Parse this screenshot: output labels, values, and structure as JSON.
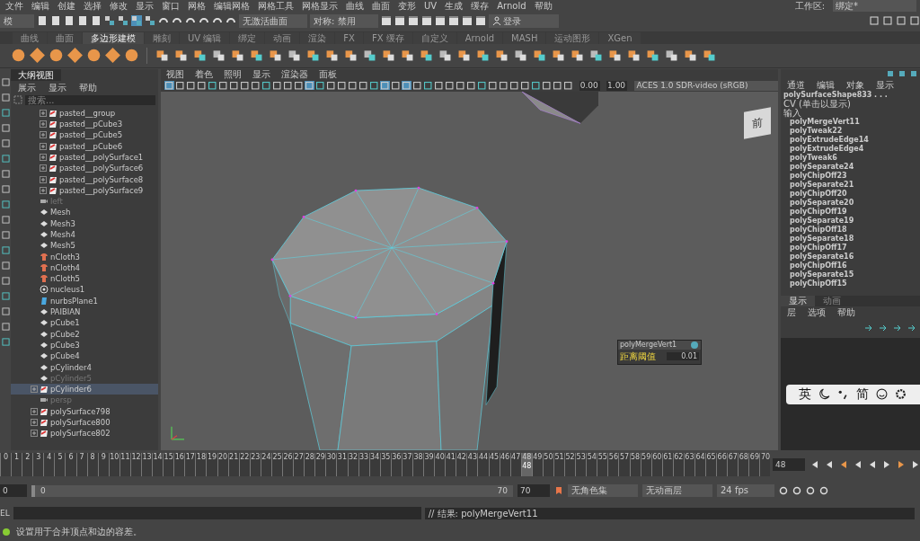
{
  "menu_bar": {
    "items": [
      "文件",
      "编辑",
      "创建",
      "选择",
      "修改",
      "显示",
      "窗口",
      "网格",
      "编辑网格",
      "网格工具",
      "网格显示",
      "曲线",
      "曲面",
      "变形",
      "UV",
      "生成",
      "缓存",
      "Arnold",
      "帮助"
    ],
    "workspace_label": "工作区:",
    "workspace": "绑定*"
  },
  "status_line": {
    "mode": "模",
    "surface": "无激活曲面",
    "symmetry": "对称: 禁用",
    "login": "登录"
  },
  "shelf_tabs": [
    {
      "label": "曲线",
      "selected": false
    },
    {
      "label": "曲面",
      "selected": false
    },
    {
      "label": "多边形建模",
      "selected": true
    },
    {
      "label": "雕刻",
      "selected": false
    },
    {
      "label": "UV 编辑",
      "selected": false
    },
    {
      "label": "绑定",
      "selected": false
    },
    {
      "label": "动画",
      "selected": false
    },
    {
      "label": "渲染",
      "selected": false
    },
    {
      "label": "FX",
      "selected": false
    },
    {
      "label": "FX 缓存",
      "selected": false
    },
    {
      "label": "自定义",
      "selected": false
    },
    {
      "label": "Arnold",
      "selected": false
    },
    {
      "label": "MASH",
      "selected": false
    },
    {
      "label": "运动图形",
      "selected": false
    },
    {
      "label": "XGen",
      "selected": false
    }
  ],
  "outliner": {
    "title": "大纲视图",
    "menu": [
      "展示",
      "显示",
      "帮助"
    ],
    "search": {
      "placeholder": "搜索..."
    },
    "nested_items": [
      {
        "name": "pasted__group",
        "kind": "group",
        "expandable": true,
        "dimmed": false,
        "selected": false
      },
      {
        "name": "pasted__pCube3",
        "kind": "group",
        "expandable": true,
        "dimmed": false,
        "selected": false
      },
      {
        "name": "pasted__pCube5",
        "kind": "group",
        "expandable": true,
        "dimmed": false,
        "selected": false
      },
      {
        "name": "pasted__pCube6",
        "kind": "group",
        "expandable": true,
        "dimmed": false,
        "selected": false
      },
      {
        "name": "pasted__polySurface1",
        "kind": "group",
        "expandable": true,
        "dimmed": false,
        "selected": false
      },
      {
        "name": "pasted__polySurface6",
        "kind": "group",
        "expandable": true,
        "dimmed": false,
        "selected": false
      },
      {
        "name": "pasted__polySurface8",
        "kind": "group",
        "expandable": true,
        "dimmed": false,
        "selected": false
      },
      {
        "name": "pasted__polySurface9",
        "kind": "group",
        "expandable": true,
        "dimmed": false,
        "selected": false
      }
    ],
    "items": [
      {
        "name": "left",
        "kind": "camera",
        "expandable": false,
        "dimmed": true,
        "selected": false
      },
      {
        "name": "Mesh",
        "kind": "mesh",
        "expandable": false,
        "dimmed": false,
        "selected": false
      },
      {
        "name": "Mesh3",
        "kind": "mesh",
        "expandable": false,
        "dimmed": false,
        "selected": false
      },
      {
        "name": "Mesh4",
        "kind": "mesh",
        "expandable": false,
        "dimmed": false,
        "selected": false
      },
      {
        "name": "Mesh5",
        "kind": "mesh",
        "expandable": false,
        "dimmed": false,
        "selected": false
      },
      {
        "name": "nCloth3",
        "kind": "cloth",
        "expandable": false,
        "dimmed": false,
        "selected": false
      },
      {
        "name": "nCloth4",
        "kind": "cloth",
        "expandable": false,
        "dimmed": false,
        "selected": false
      },
      {
        "name": "nCloth5",
        "kind": "cloth",
        "expandable": false,
        "dimmed": false,
        "selected": false
      },
      {
        "name": "nucleus1",
        "kind": "nucleus",
        "expandable": false,
        "dimmed": false,
        "selected": false
      },
      {
        "name": "nurbsPlane1",
        "kind": "nurbs",
        "expandable": false,
        "dimmed": false,
        "selected": false
      },
      {
        "name": "PAIBIAN",
        "kind": "mesh",
        "expandable": false,
        "dimmed": false,
        "selected": false
      },
      {
        "name": "pCube1",
        "kind": "mesh",
        "expandable": false,
        "dimmed": false,
        "selected": false
      },
      {
        "name": "pCube2",
        "kind": "mesh",
        "expandable": false,
        "dimmed": false,
        "selected": false
      },
      {
        "name": "pCube3",
        "kind": "mesh",
        "expandable": false,
        "dimmed": false,
        "selected": false
      },
      {
        "name": "pCube4",
        "kind": "mesh",
        "expandable": false,
        "dimmed": false,
        "selected": false
      },
      {
        "name": "pCylinder4",
        "kind": "mesh",
        "expandable": false,
        "dimmed": false,
        "selected": false
      },
      {
        "name": "pCylinder5",
        "kind": "mesh",
        "expandable": false,
        "dimmed": true,
        "selected": false
      },
      {
        "name": "pCylinder6",
        "kind": "group",
        "expandable": true,
        "dimmed": false,
        "selected": true
      },
      {
        "name": "persp",
        "kind": "camera",
        "expandable": false,
        "dimmed": true,
        "selected": false
      },
      {
        "name": "polySurface798",
        "kind": "group",
        "expandable": true,
        "dimmed": false,
        "selected": false
      },
      {
        "name": "polySurface800",
        "kind": "group",
        "expandable": true,
        "dimmed": false,
        "selected": false
      },
      {
        "name": "polySurface802",
        "kind": "group",
        "expandable": true,
        "dimmed": false,
        "selected": false
      }
    ]
  },
  "viewport": {
    "menu": [
      "视图",
      "着色",
      "照明",
      "显示",
      "渲染器",
      "面板"
    ],
    "exposure": "0.00",
    "gamma": "1.00",
    "color_space": "ACES 1.0 SDR-video (sRGB)",
    "view_cube": "前",
    "merge_popup": {
      "title": "polyMergeVert1",
      "label": "距离阈值",
      "value": "0.01"
    }
  },
  "ime_bar": [
    {
      "kind": "text",
      "label": "英"
    },
    {
      "kind": "moon"
    },
    {
      "kind": "punct"
    },
    {
      "kind": "text",
      "label": "简"
    },
    {
      "kind": "smile"
    },
    {
      "kind": "gear"
    }
  ],
  "channel_box": {
    "menu": [
      "通道",
      "编辑",
      "对象",
      "显示"
    ],
    "shape": "polySurfaceShape833 . . .",
    "cv": "CV (单击以显示)",
    "inputs_label": "输入",
    "inputs": [
      "polyMergeVert11",
      "polyTweak22",
      "polyExtrudeEdge14",
      "polyExtrudeEdge4",
      "polyTweak6",
      "polySeparate24",
      "polyChipOff23",
      "polySeparate21",
      "polyChipOff20",
      "polySeparate20",
      "polyChipOff19",
      "polySeparate19",
      "polyChipOff18",
      "polySeparate18",
      "polyChipOff17",
      "polySeparate16",
      "polyChipOff16",
      "polySeparate15",
      "polyChipOff15"
    ]
  },
  "layer_editor": {
    "tabs": [
      {
        "label": "显示",
        "selected": true
      },
      {
        "label": "动画",
        "selected": false
      }
    ],
    "menu": [
      "层",
      "选项",
      "帮助"
    ]
  },
  "timeline": {
    "ticks": [
      {
        "label": "0",
        "selected": false
      },
      {
        "label": "1",
        "selected": false
      },
      {
        "label": "2",
        "selected": false
      },
      {
        "label": "3",
        "selected": false
      },
      {
        "label": "4",
        "selected": false
      },
      {
        "label": "5",
        "selected": false
      },
      {
        "label": "6",
        "selected": false
      },
      {
        "label": "7",
        "selected": false
      },
      {
        "label": "8",
        "selected": false
      },
      {
        "label": "9",
        "selected": false
      },
      {
        "label": "10",
        "selected": false
      },
      {
        "label": "11",
        "selected": false
      },
      {
        "label": "12",
        "selected": false
      },
      {
        "label": "13",
        "selected": false
      },
      {
        "label": "14",
        "selected": false
      },
      {
        "label": "15",
        "selected": false
      },
      {
        "label": "16",
        "selected": false
      },
      {
        "label": "17",
        "selected": false
      },
      {
        "label": "18",
        "selected": false
      },
      {
        "label": "19",
        "selected": false
      },
      {
        "label": "20",
        "selected": false
      },
      {
        "label": "21",
        "selected": false
      },
      {
        "label": "22",
        "selected": false
      },
      {
        "label": "23",
        "selected": false
      },
      {
        "label": "24",
        "selected": false
      },
      {
        "label": "25",
        "selected": false
      },
      {
        "label": "26",
        "selected": false
      },
      {
        "label": "27",
        "selected": false
      },
      {
        "label": "28",
        "selected": false
      },
      {
        "label": "29",
        "selected": false
      },
      {
        "label": "30",
        "selected": false
      },
      {
        "label": "31",
        "selected": false
      },
      {
        "label": "32",
        "selected": false
      },
      {
        "label": "33",
        "selected": false
      },
      {
        "label": "34",
        "selected": false
      },
      {
        "label": "35",
        "selected": false
      },
      {
        "label": "36",
        "selected": false
      },
      {
        "label": "37",
        "selected": false
      },
      {
        "label": "38",
        "selected": false
      },
      {
        "label": "39",
        "selected": false
      },
      {
        "label": "40",
        "selected": false
      },
      {
        "label": "41",
        "selected": false
      },
      {
        "label": "42",
        "selected": false
      },
      {
        "label": "43",
        "selected": false
      },
      {
        "label": "44",
        "selected": false
      },
      {
        "label": "45",
        "selected": false
      },
      {
        "label": "46",
        "selected": false
      },
      {
        "label": "47",
        "selected": false
      },
      {
        "label": "48",
        "selected": true
      },
      {
        "label": "49",
        "selected": false
      },
      {
        "label": "50",
        "selected": false
      },
      {
        "label": "51",
        "selected": false
      },
      {
        "label": "52",
        "selected": false
      },
      {
        "label": "53",
        "selected": false
      },
      {
        "label": "54",
        "selected": false
      },
      {
        "label": "55",
        "selected": false
      },
      {
        "label": "56",
        "selected": false
      },
      {
        "label": "57",
        "selected": false
      },
      {
        "label": "58",
        "selected": false
      },
      {
        "label": "59",
        "selected": false
      },
      {
        "label": "60",
        "selected": false
      },
      {
        "label": "61",
        "selected": false
      },
      {
        "label": "62",
        "selected": false
      },
      {
        "label": "63",
        "selected": false
      },
      {
        "label": "64",
        "selected": false
      },
      {
        "label": "65",
        "selected": false
      },
      {
        "label": "66",
        "selected": false
      },
      {
        "label": "67",
        "selected": false
      },
      {
        "label": "68",
        "selected": false
      },
      {
        "label": "69",
        "selected": false
      },
      {
        "label": "70",
        "selected": false
      }
    ],
    "current_label": "48",
    "current_field": "48"
  },
  "range": {
    "outer_start": "0",
    "start": "0",
    "end": "70",
    "outer_end": "70",
    "character_set": "无角色集",
    "anim_layer": "无动画层",
    "fps": "24 fps"
  },
  "command_line": {
    "language": "EL",
    "result": "// 结果: polyMergeVert11"
  },
  "help_line": "设置用于合并顶点和边的容差。"
}
